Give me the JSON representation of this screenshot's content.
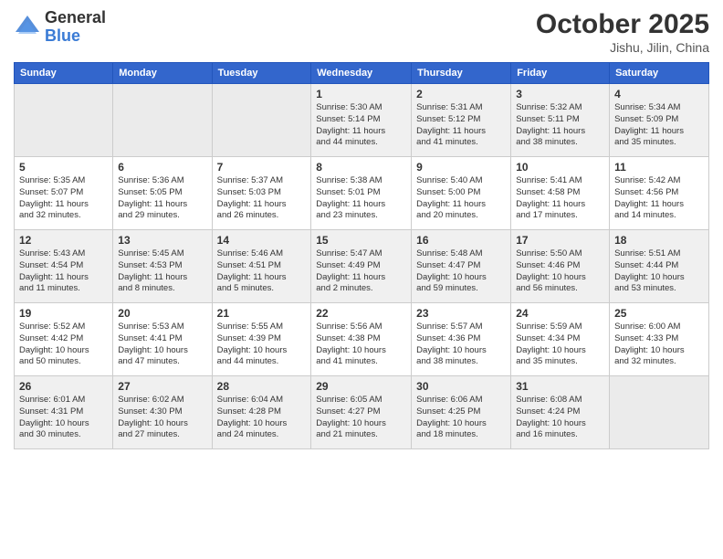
{
  "header": {
    "logo_line1": "General",
    "logo_line2": "Blue",
    "month": "October 2025",
    "location": "Jishu, Jilin, China"
  },
  "weekdays": [
    "Sunday",
    "Monday",
    "Tuesday",
    "Wednesday",
    "Thursday",
    "Friday",
    "Saturday"
  ],
  "weeks": [
    [
      {
        "day": "",
        "info": ""
      },
      {
        "day": "",
        "info": ""
      },
      {
        "day": "",
        "info": ""
      },
      {
        "day": "1",
        "info": "Sunrise: 5:30 AM\nSunset: 5:14 PM\nDaylight: 11 hours\nand 44 minutes."
      },
      {
        "day": "2",
        "info": "Sunrise: 5:31 AM\nSunset: 5:12 PM\nDaylight: 11 hours\nand 41 minutes."
      },
      {
        "day": "3",
        "info": "Sunrise: 5:32 AM\nSunset: 5:11 PM\nDaylight: 11 hours\nand 38 minutes."
      },
      {
        "day": "4",
        "info": "Sunrise: 5:34 AM\nSunset: 5:09 PM\nDaylight: 11 hours\nand 35 minutes."
      }
    ],
    [
      {
        "day": "5",
        "info": "Sunrise: 5:35 AM\nSunset: 5:07 PM\nDaylight: 11 hours\nand 32 minutes."
      },
      {
        "day": "6",
        "info": "Sunrise: 5:36 AM\nSunset: 5:05 PM\nDaylight: 11 hours\nand 29 minutes."
      },
      {
        "day": "7",
        "info": "Sunrise: 5:37 AM\nSunset: 5:03 PM\nDaylight: 11 hours\nand 26 minutes."
      },
      {
        "day": "8",
        "info": "Sunrise: 5:38 AM\nSunset: 5:01 PM\nDaylight: 11 hours\nand 23 minutes."
      },
      {
        "day": "9",
        "info": "Sunrise: 5:40 AM\nSunset: 5:00 PM\nDaylight: 11 hours\nand 20 minutes."
      },
      {
        "day": "10",
        "info": "Sunrise: 5:41 AM\nSunset: 4:58 PM\nDaylight: 11 hours\nand 17 minutes."
      },
      {
        "day": "11",
        "info": "Sunrise: 5:42 AM\nSunset: 4:56 PM\nDaylight: 11 hours\nand 14 minutes."
      }
    ],
    [
      {
        "day": "12",
        "info": "Sunrise: 5:43 AM\nSunset: 4:54 PM\nDaylight: 11 hours\nand 11 minutes."
      },
      {
        "day": "13",
        "info": "Sunrise: 5:45 AM\nSunset: 4:53 PM\nDaylight: 11 hours\nand 8 minutes."
      },
      {
        "day": "14",
        "info": "Sunrise: 5:46 AM\nSunset: 4:51 PM\nDaylight: 11 hours\nand 5 minutes."
      },
      {
        "day": "15",
        "info": "Sunrise: 5:47 AM\nSunset: 4:49 PM\nDaylight: 11 hours\nand 2 minutes."
      },
      {
        "day": "16",
        "info": "Sunrise: 5:48 AM\nSunset: 4:47 PM\nDaylight: 10 hours\nand 59 minutes."
      },
      {
        "day": "17",
        "info": "Sunrise: 5:50 AM\nSunset: 4:46 PM\nDaylight: 10 hours\nand 56 minutes."
      },
      {
        "day": "18",
        "info": "Sunrise: 5:51 AM\nSunset: 4:44 PM\nDaylight: 10 hours\nand 53 minutes."
      }
    ],
    [
      {
        "day": "19",
        "info": "Sunrise: 5:52 AM\nSunset: 4:42 PM\nDaylight: 10 hours\nand 50 minutes."
      },
      {
        "day": "20",
        "info": "Sunrise: 5:53 AM\nSunset: 4:41 PM\nDaylight: 10 hours\nand 47 minutes."
      },
      {
        "day": "21",
        "info": "Sunrise: 5:55 AM\nSunset: 4:39 PM\nDaylight: 10 hours\nand 44 minutes."
      },
      {
        "day": "22",
        "info": "Sunrise: 5:56 AM\nSunset: 4:38 PM\nDaylight: 10 hours\nand 41 minutes."
      },
      {
        "day": "23",
        "info": "Sunrise: 5:57 AM\nSunset: 4:36 PM\nDaylight: 10 hours\nand 38 minutes."
      },
      {
        "day": "24",
        "info": "Sunrise: 5:59 AM\nSunset: 4:34 PM\nDaylight: 10 hours\nand 35 minutes."
      },
      {
        "day": "25",
        "info": "Sunrise: 6:00 AM\nSunset: 4:33 PM\nDaylight: 10 hours\nand 32 minutes."
      }
    ],
    [
      {
        "day": "26",
        "info": "Sunrise: 6:01 AM\nSunset: 4:31 PM\nDaylight: 10 hours\nand 30 minutes."
      },
      {
        "day": "27",
        "info": "Sunrise: 6:02 AM\nSunset: 4:30 PM\nDaylight: 10 hours\nand 27 minutes."
      },
      {
        "day": "28",
        "info": "Sunrise: 6:04 AM\nSunset: 4:28 PM\nDaylight: 10 hours\nand 24 minutes."
      },
      {
        "day": "29",
        "info": "Sunrise: 6:05 AM\nSunset: 4:27 PM\nDaylight: 10 hours\nand 21 minutes."
      },
      {
        "day": "30",
        "info": "Sunrise: 6:06 AM\nSunset: 4:25 PM\nDaylight: 10 hours\nand 18 minutes."
      },
      {
        "day": "31",
        "info": "Sunrise: 6:08 AM\nSunset: 4:24 PM\nDaylight: 10 hours\nand 16 minutes."
      },
      {
        "day": "",
        "info": ""
      }
    ]
  ]
}
